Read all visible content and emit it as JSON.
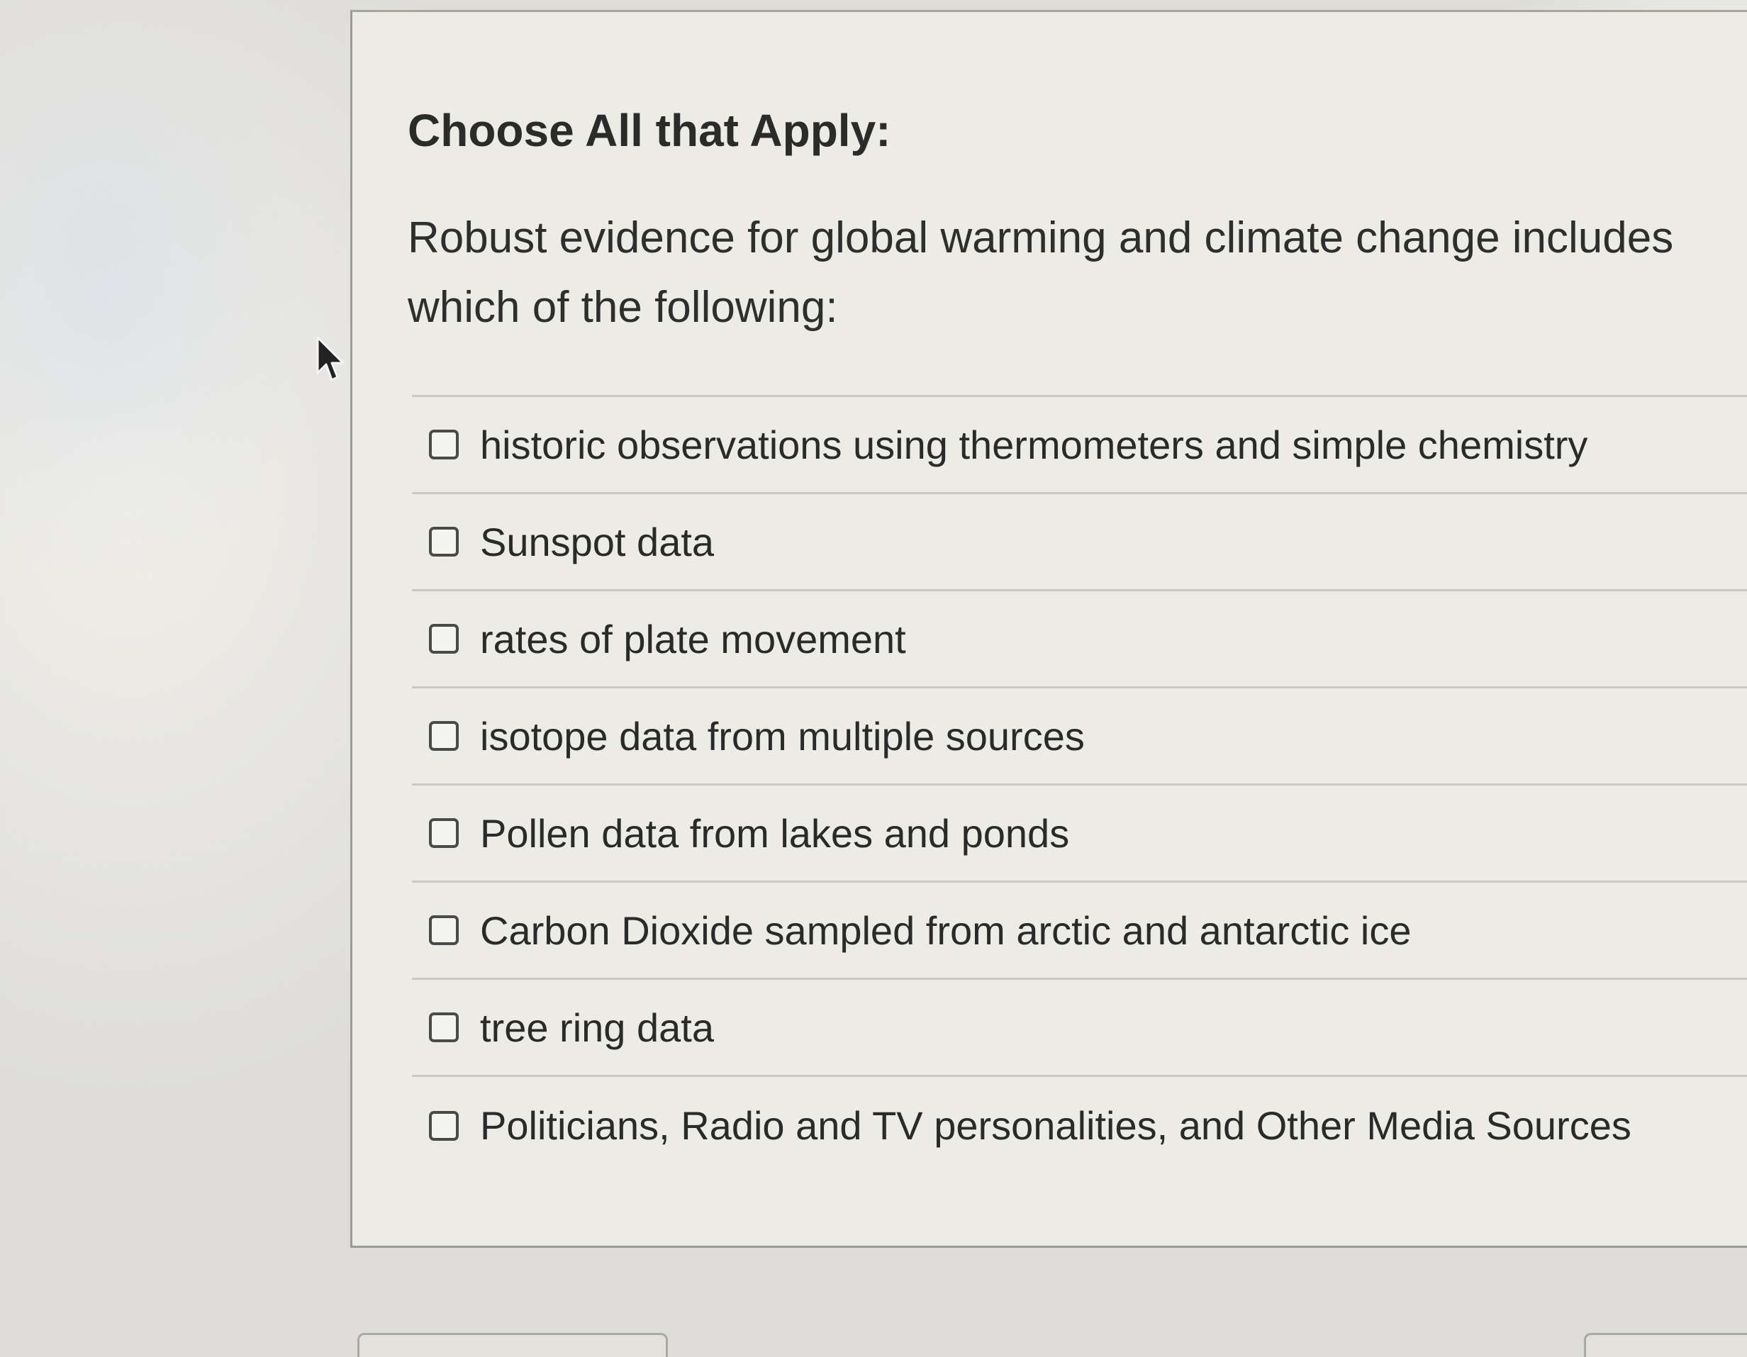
{
  "quiz": {
    "instruction": "Choose All that Apply:",
    "question": "Robust evidence for global warming and climate change includes which of the following:",
    "options": [
      {
        "label": "historic observations using thermometers and simple chemistry",
        "checked": false
      },
      {
        "label": "Sunspot data",
        "checked": false
      },
      {
        "label": "rates of plate movement",
        "checked": false
      },
      {
        "label": "isotope data from multiple sources",
        "checked": false
      },
      {
        "label": "Pollen data from lakes and ponds",
        "checked": false
      },
      {
        "label": "Carbon Dioxide sampled from arctic and antarctic ice",
        "checked": false
      },
      {
        "label": "tree ring data",
        "checked": false
      },
      {
        "label": "Politicians, Radio and TV personalities, and Other Media Sources",
        "checked": false
      }
    ]
  },
  "icons": {
    "cursor": "mouse-pointer-icon",
    "checkbox": "checkbox-unchecked-icon"
  }
}
